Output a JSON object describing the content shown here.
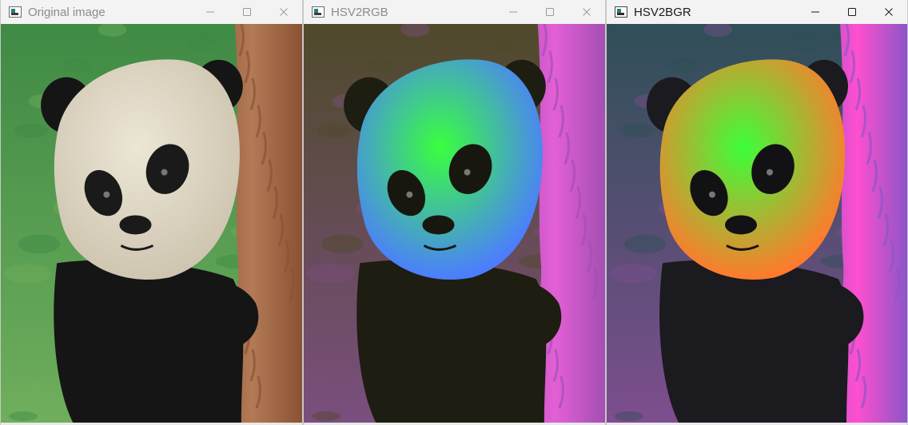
{
  "windows": [
    {
      "title": "Original image",
      "active": false,
      "variant": "original",
      "icon": "opencv-app-icon",
      "controls": [
        "minimize-icon",
        "maximize-icon",
        "close-icon"
      ],
      "palette": {
        "background_grass": "#3f8a45",
        "grass_light": "#6fae5c",
        "fur_white": "#ece6d6",
        "fur_shade": "#cfc6b1",
        "fur_black": "#151515",
        "bark": "#8a5233",
        "bark_light": "#b27a55",
        "eye_patch": "#1a1a1a"
      }
    },
    {
      "title": "HSV2RGB",
      "active": false,
      "variant": "hsv2rgb",
      "icon": "opencv-app-icon",
      "controls": [
        "minimize-icon",
        "maximize-icon",
        "close-icon"
      ],
      "palette": {
        "background_grass": "#4f4a2a",
        "grass_light": "#7a4e7e",
        "fur_white": "#39ff3d",
        "fur_shade": "#4c7dff",
        "fur_black": "#1d1d12",
        "bark": "#a44fb3",
        "bark_light": "#e35fd6",
        "eye_patch": "#171710"
      }
    },
    {
      "title": "HSV2BGR",
      "active": true,
      "variant": "hsv2bgr",
      "icon": "opencv-app-icon",
      "controls": [
        "minimize-icon",
        "maximize-icon",
        "close-icon"
      ],
      "palette": {
        "background_grass": "#2f4f57",
        "grass_light": "#7d4e8e",
        "fur_white": "#3cff3a",
        "fur_shade": "#ff7a2d",
        "fur_black": "#1a1a1f",
        "bark": "#8c56c7",
        "bark_light": "#ff4fcf",
        "eye_patch": "#121214"
      }
    }
  ]
}
